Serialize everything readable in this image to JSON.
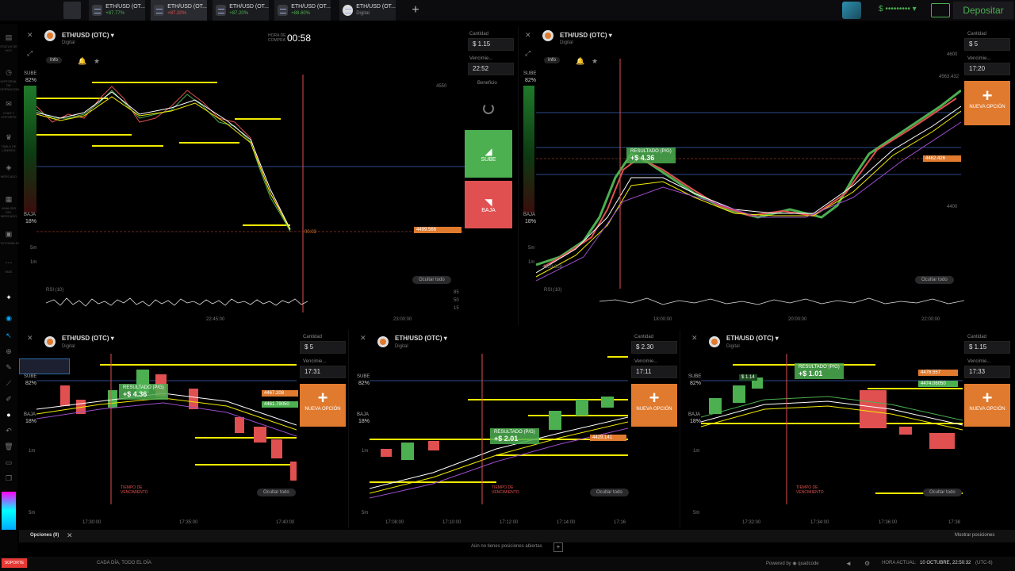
{
  "topbar": {
    "tabs": [
      {
        "name": "ETH/USD (OT...",
        "pct": "+87.77%",
        "pct_color": "green"
      },
      {
        "name": "ETH/USD (OT...",
        "pct": "+87.20%",
        "pct_color": "red"
      },
      {
        "name": "ETH/USD (OT...",
        "pct": "+87.20%",
        "pct_color": "green"
      },
      {
        "name": "ETH/USD (OT...",
        "pct": "+88.60%",
        "pct_color": "green"
      },
      {
        "name": "ETH/USD (OT...",
        "pct": "Digital",
        "pct_color": "grey"
      }
    ],
    "add_tab": "+",
    "balance": "$ ••••••••• ▾",
    "deposit_label": "Depositar"
  },
  "colors": {
    "accent_orange": "#e07a2e",
    "up_green": "#4caf50",
    "down_red": "#e05050",
    "ma_yellow": "#f2ea00"
  },
  "left_toolbar": [
    "STATUS DE HOY",
    "HISTORIAL DE OPERACIONES",
    "CHAT Y SOPORTE",
    "TABLA DE LÍDERES",
    "MERCADO",
    "ANÁLISIS DEL MERCADO",
    "TUTORIALES",
    "MÁS"
  ],
  "panels": {
    "top_left": {
      "title": "ETH/USD (OTC) ▾",
      "sub": "Digital",
      "info": "Info",
      "hora_label": "HORA DE COMPRA",
      "countdown": "00:58",
      "sube": "SUBE",
      "sube_pct": "82%",
      "baja": "BAJA",
      "baja_pct": "18%",
      "cantidad_label": "Cantidad",
      "cantidad": "$ 1.15",
      "vencimiento_label": "Vencimie...",
      "vencimiento": "22:52",
      "beneficio_label": "Beneficio",
      "sube_btn": "SUBE",
      "baja_btn": "BAJA",
      "price_tag": "4499.566",
      "timer_tag": "00:03",
      "price_4550": "4550",
      "ocultar": "Ocultar todo",
      "rsi": "RSI (10)",
      "rsi_85": "85",
      "rsi_50": "50",
      "rsi_15": "15",
      "times": [
        "22:45:00",
        "23:00:00"
      ],
      "intervals": [
        "5m",
        "1m"
      ]
    },
    "top_right": {
      "title": "ETH/USD (OTC) ▾",
      "sub": "Digital",
      "info": "Info",
      "sube": "SUBE",
      "sube_pct": "82%",
      "baja": "BAJA",
      "baja_pct": "18%",
      "cantidad_label": "Cantidad",
      "cantidad": "$ 5",
      "vencimiento_label": "Vencimie...",
      "vencimiento": "17:20",
      "nueva": "NUEVA OPCIÓN",
      "result_title": "RESULTADO (P/G)",
      "result_value": "+$ 4.36",
      "price_tag": "4462.426",
      "y_labels": [
        "4600",
        "4563.432",
        "4400",
        "4329.358"
      ],
      "ocultar": "Ocultar todo",
      "rsi": "RSI (10)",
      "times": [
        "18:00:00",
        "20:00:00",
        "22:00:00"
      ],
      "intervals": [
        "5m",
        "1m"
      ]
    },
    "bottom_1": {
      "title": "ETH/USD (OTC) ▾",
      "sub": "Digital",
      "sube": "SUBE",
      "sube_pct": "82%",
      "baja": "BAJA",
      "baja_pct": "18%",
      "cantidad_label": "Cantidad",
      "cantidad": "$ 5",
      "vencimiento_label": "Vencimie...",
      "vencimiento": "17:31",
      "nueva": "NUEVA OPCIÓN",
      "result_title": "RESULTADO (P/G)",
      "result_value": "+$ 4.36",
      "price_tag": "4467.208",
      "price_tag2": "4461.79050",
      "tiempo": "TIEMPO DE VENCIMIENTO",
      "ocultar": "Ocultar todo",
      "times": [
        "17:30:00",
        "17:35:00",
        "17:40:00"
      ],
      "intervals": [
        "1m",
        "5m"
      ]
    },
    "bottom_2": {
      "title": "ETH/USD (OTC) ▾",
      "sub": "Digital",
      "sube": "SUBE",
      "sube_pct": "82%",
      "baja": "BAJA",
      "baja_pct": "18%",
      "cantidad_label": "Cantidad",
      "cantidad": "$ 2.30",
      "vencimiento_label": "Vencimie...",
      "vencimiento": "17:11",
      "nueva": "NUEVA OPCIÓN",
      "result_title": "RESULTADO (P/G)",
      "result_value": "+$ 2.01",
      "price_tag": "4429.141",
      "tiempo": "TIEMPO DE VENCIMIENTO",
      "ocultar": "Ocultar todo",
      "times": [
        "17:08:00",
        "17:10:00",
        "17:12:00",
        "17:14:00",
        "17:16"
      ],
      "intervals": [
        "1m",
        "5m"
      ]
    },
    "bottom_3": {
      "title": "ETH/USD (OTC) ▾",
      "sub": "Digital",
      "sube": "SUBE",
      "sube_pct": "82%",
      "baja": "BAJA",
      "baja_pct": "18%",
      "cantidad_label": "Cantidad",
      "cantidad": "$ 1.15",
      "vencimiento_label": "Vencimie...",
      "vencimiento": "17:33",
      "nueva": "NUEVA OPCIÓN",
      "result_title": "RESULTADO (P/G)",
      "result_value": "+$ 1.01",
      "result_chip": "$ 1.14",
      "price_tag": "4476.557",
      "price_tag2": "4474.06050",
      "tiempo": "TIEMPO DE VENCIMIENTO",
      "ocultar": "Ocultar todo",
      "times": [
        "17:32:00",
        "17:34:00",
        "17:36:00",
        "17:38"
      ],
      "intervals": [
        "1m",
        "5m"
      ]
    }
  },
  "options_bar": {
    "label": "Opciones (0)",
    "empty": "Aún no tienes posiciones abiertas",
    "add": "+",
    "show": "Mostrar posiciones"
  },
  "footer": {
    "soporte": "SOPORTE",
    "slogan": "CADA DÍA, TODO EL DÍA",
    "powered": "Powered by ◉ quadcode",
    "hora_label": "HORA ACTUAL:",
    "hora": "10 OCTUBRE, 22:50:32",
    "tz": "(UTC-6)"
  }
}
